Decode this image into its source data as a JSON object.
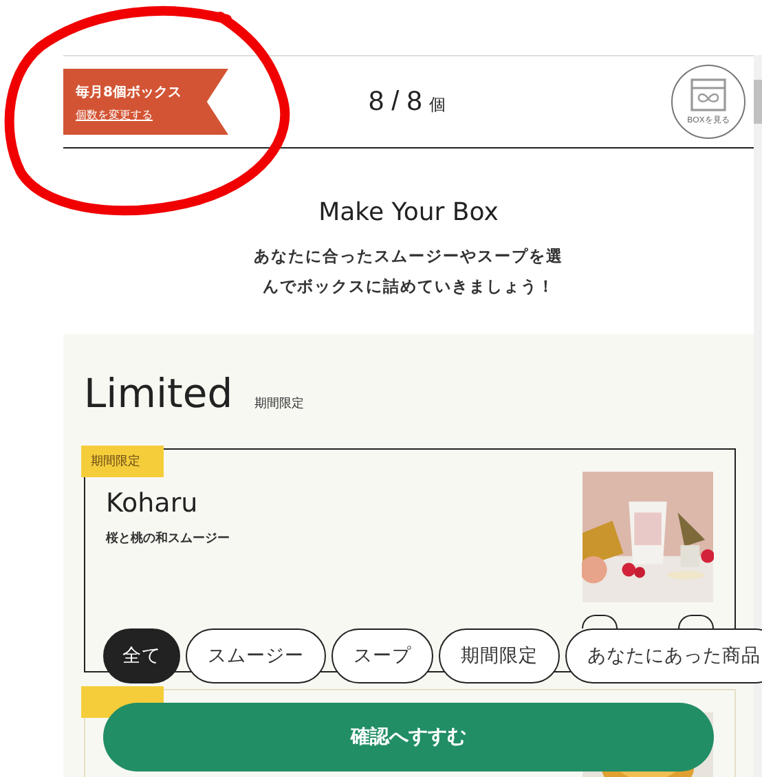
{
  "header": {
    "badge_title": "毎月8個ボックス",
    "badge_link": "個数を変更する",
    "count": "8 / 8",
    "count_unit": "個",
    "box_button": "BOXを見る"
  },
  "intro": {
    "title": "Make Your Box",
    "description": "あなたに合ったスムージーやスープを選んでボックスに詰めていきましょう！"
  },
  "section": {
    "title": "Limited",
    "subtitle": "期間限定"
  },
  "products": [
    {
      "tag": "期間限定",
      "name": "Koharu",
      "description": "桜と桃の和スムージー",
      "image": {
        "kind": "picture"
      }
    },
    {
      "image": {
        "kind": "picture"
      }
    }
  ],
  "filters": [
    {
      "label": "全て",
      "selected": true
    },
    {
      "label": "スムージー",
      "selected": false
    },
    {
      "label": "スープ",
      "selected": false
    },
    {
      "label": "期間限定",
      "selected": false
    },
    {
      "label": "あなたにあった商品",
      "selected": false
    }
  ],
  "confirm_button": "確認へすすむ"
}
